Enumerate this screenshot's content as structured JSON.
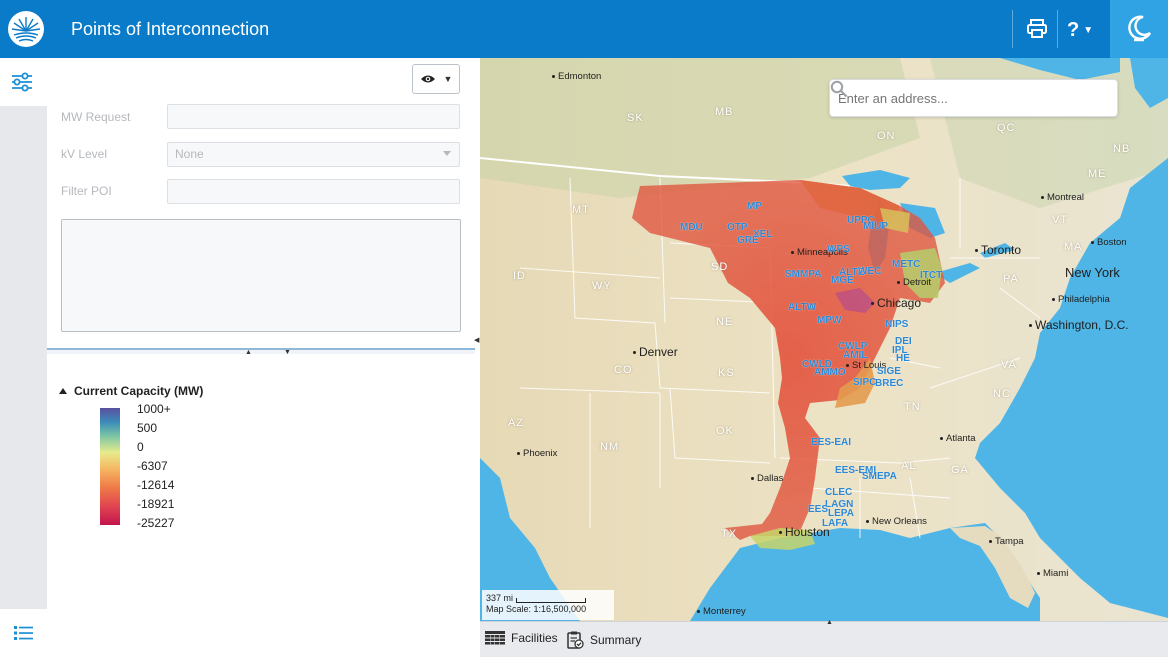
{
  "header": {
    "title": "Points of Interconnection",
    "help_label": "?"
  },
  "form": {
    "mw_request_label": "MW Request",
    "mw_request_value": "",
    "kv_level_label": "kV Level",
    "kv_level_value": "None",
    "filter_poi_label": "Filter POI",
    "filter_poi_value": ""
  },
  "legend": {
    "title": "Current Capacity (MW)",
    "labels": [
      "1000+",
      "500",
      "0",
      "-6307",
      "-12614",
      "-18921",
      "-25227"
    ]
  },
  "map": {
    "search_placeholder": "Enter an address...",
    "scale_distance": "337 mi",
    "scale_text": "Map Scale: 1:16,500,000",
    "cities": {
      "edmonton": "Edmonton",
      "minneapolis": "Minneapolis",
      "detroit": "Detroit",
      "chicago": "Chicago",
      "denver": "Denver",
      "st_louis": "St Louis",
      "toronto": "Toronto",
      "montreal": "Montreal",
      "boston": "Boston",
      "new_york": "New York",
      "philadelphia": "Philadelphia",
      "washington": "Washington, D.C.",
      "atlanta": "Atlanta",
      "phoenix": "Phoenix",
      "dallas": "Dallas",
      "houston": "Houston",
      "new_orleans": "New Orleans",
      "tampa": "Tampa",
      "miami": "Miami",
      "monterrey": "Monterrey"
    },
    "regions": [
      "SK",
      "MB",
      "ON",
      "QC",
      "NB",
      "ME",
      "VT",
      "MA",
      "MT",
      "ID",
      "WY",
      "SD",
      "NE",
      "CO",
      "KS",
      "OK",
      "NM",
      "AZ",
      "TX",
      "TN",
      "AL",
      "GA",
      "NC",
      "VA",
      "PA"
    ],
    "zones": [
      "MP",
      "MDU",
      "OTP",
      "XEL",
      "GRE",
      "UPPC",
      "MIUP",
      "WPS",
      "SMMPA",
      "MGE",
      "ALTE",
      "WEC",
      "METC",
      "ITCT",
      "ALTW",
      "MPW",
      "NIPS",
      "CWLP",
      "AMIL",
      "DEI",
      "IPL",
      "HE",
      "CWLD",
      "AMMO",
      "SIGE",
      "SIPC",
      "BREC",
      "EES-EAI",
      "EES-EMI",
      "SMEPA",
      "CLEC",
      "LAGN",
      "EES",
      "LEPA",
      "LAFA"
    ]
  },
  "tabs": {
    "facilities": "Facilities",
    "summary": "Summary"
  }
}
